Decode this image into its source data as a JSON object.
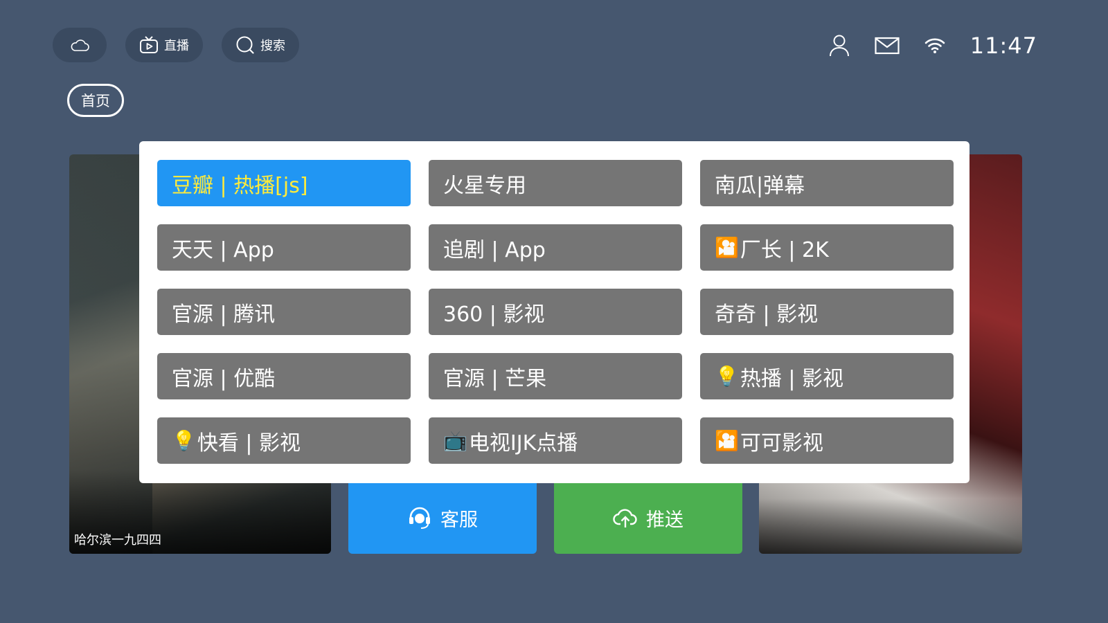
{
  "top_bar": {
    "cloud_icon": "cloud-icon",
    "live_label": "直播",
    "search_label": "搜索"
  },
  "status_bar": {
    "icons": [
      "user-icon",
      "mail-icon",
      "wifi-icon"
    ],
    "time": "11:47"
  },
  "nav": {
    "home_tab": "首页"
  },
  "posters": {
    "left_caption": "哈尔滨一九四四"
  },
  "actions": {
    "service_label": "客服",
    "push_label": "推送",
    "colors": {
      "service": "#2196f3",
      "push": "#4caf50"
    }
  },
  "source_dialog": {
    "selected_index": 0,
    "selected_text_color": "#ffeb3b",
    "options": [
      {
        "emoji": "",
        "label": "豆瓣 | 热播[js]"
      },
      {
        "emoji": "",
        "label": "火星专用"
      },
      {
        "emoji": "",
        "label": "南瓜|弹幕"
      },
      {
        "emoji": "",
        "label": "天天 | App"
      },
      {
        "emoji": "",
        "label": "追剧 | App"
      },
      {
        "emoji": "🎦",
        "label": "厂长 | 2K"
      },
      {
        "emoji": "",
        "label": "官源  | 腾讯"
      },
      {
        "emoji": "",
        "label": "360  | 影视"
      },
      {
        "emoji": "",
        "label": "奇奇 | 影视"
      },
      {
        "emoji": "",
        "label": "官源  | 优酷"
      },
      {
        "emoji": "",
        "label": "官源  | 芒果"
      },
      {
        "emoji": "💡",
        "label": "热播 | 影视"
      },
      {
        "emoji": "💡",
        "label": "快看 | 影视"
      },
      {
        "emoji": "📺",
        "label": "电视IJK点播"
      },
      {
        "emoji": "🎦",
        "label": "可可影视"
      }
    ]
  }
}
